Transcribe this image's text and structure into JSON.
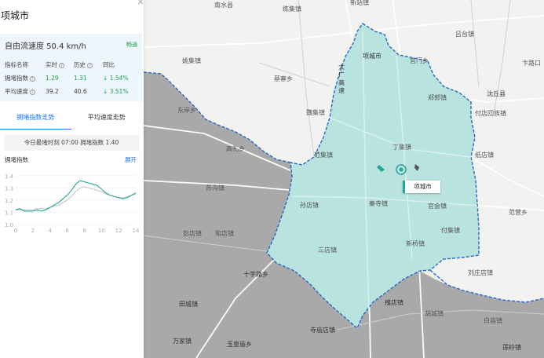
{
  "panel": {
    "city": "项城市",
    "close": "×",
    "free_flow": "自由流速度 50.4 km/h",
    "status": "畅通",
    "table": {
      "headers": [
        "指标名称",
        "实时",
        "历史",
        "同比"
      ],
      "rows": [
        {
          "name": "拥堵指数",
          "realtime": "1.29",
          "history": "1.31",
          "yoy": "↓ 1.54%"
        },
        {
          "name": "平均速度",
          "realtime": "39.2",
          "history": "40.6",
          "yoy": "↓ 3.51%"
        }
      ]
    },
    "tabs": [
      "拥堵指数走势",
      "平均速度走势"
    ],
    "peak": "今日最堵时刻 07:00   拥堵指数 1.40",
    "chart_title": "拥堵指数",
    "expand": "展开",
    "help": "?"
  },
  "chart_data": {
    "type": "line",
    "ylabel": "拥堵指数",
    "x_ticks": [
      "0",
      "2",
      "4",
      "6",
      "8",
      "10",
      "12",
      "14"
    ],
    "y_ticks": [
      "1.0",
      "1.1",
      "1.2",
      "1.3",
      "1.4"
    ],
    "ylim": [
      1.0,
      1.45
    ],
    "xlim": [
      0,
      14
    ],
    "series": [
      {
        "color": "#26a69a",
        "x": [
          0,
          0.5,
          1,
          1.5,
          2,
          2.5,
          3,
          3.5,
          4,
          4.5,
          5,
          5.5,
          6,
          6.5,
          7,
          7.5,
          8,
          8.5,
          9,
          9.5,
          10,
          10.5,
          11,
          11.5,
          12,
          12.5,
          13,
          13.5,
          14
        ],
        "y": [
          1.12,
          1.13,
          1.11,
          1.11,
          1.11,
          1.12,
          1.11,
          1.12,
          1.14,
          1.16,
          1.18,
          1.21,
          1.24,
          1.28,
          1.33,
          1.36,
          1.35,
          1.34,
          1.33,
          1.32,
          1.29,
          1.26,
          1.24,
          1.23,
          1.22,
          1.21,
          1.22,
          1.24,
          1.26
        ]
      },
      {
        "color": "#c8c8c8",
        "x": [
          0,
          0.5,
          1,
          1.5,
          2,
          2.5,
          3,
          3.5,
          4,
          4.5,
          5,
          5.5,
          6,
          6.5,
          7,
          7.5,
          8,
          8.5,
          9,
          9.5,
          10,
          10.5,
          11,
          11.5,
          12,
          12.5,
          13,
          13.5,
          14
        ],
        "y": [
          1.12,
          1.12,
          1.12,
          1.12,
          1.12,
          1.13,
          1.13,
          1.13,
          1.14,
          1.15,
          1.16,
          1.18,
          1.2,
          1.23,
          1.27,
          1.3,
          1.31,
          1.3,
          1.29,
          1.28,
          1.27,
          1.25,
          1.24,
          1.23,
          1.22,
          1.22,
          1.23,
          1.24,
          1.25
        ]
      }
    ]
  },
  "map": {
    "highlight_label": "项城市",
    "colors": {
      "region_fill": "#b9e3de",
      "outside_fill": "#a9a9a9",
      "background": "#f2f3f1",
      "border": "#2a66c7"
    },
    "places": [
      "南水县",
      "练集镇",
      "新站镇",
      "吕台镇",
      "卞路口",
      "姚集镇",
      "项城市",
      "官门乡",
      "大广高速",
      "蔡寨乡",
      "郑郭镇",
      "沈丘县",
      "魏集镇",
      "付店回族镇",
      "东岸乡",
      "高礼乡",
      "范集镇",
      "丁集镇",
      "纸店镇",
      "苏沟镇",
      "孙店镇",
      "秦寺镇",
      "官会镇",
      "范营乡",
      "付集镇",
      "彭店镇",
      "和店镇",
      "三店镇",
      "新桥镇",
      "十字路乡",
      "刘庄店镇",
      "田城镇",
      "槐店镇",
      "胡城镇",
      "白庙镇",
      "万家镇",
      "玉皇庙乡",
      "寺庙店镇",
      "莲岭镇"
    ]
  }
}
